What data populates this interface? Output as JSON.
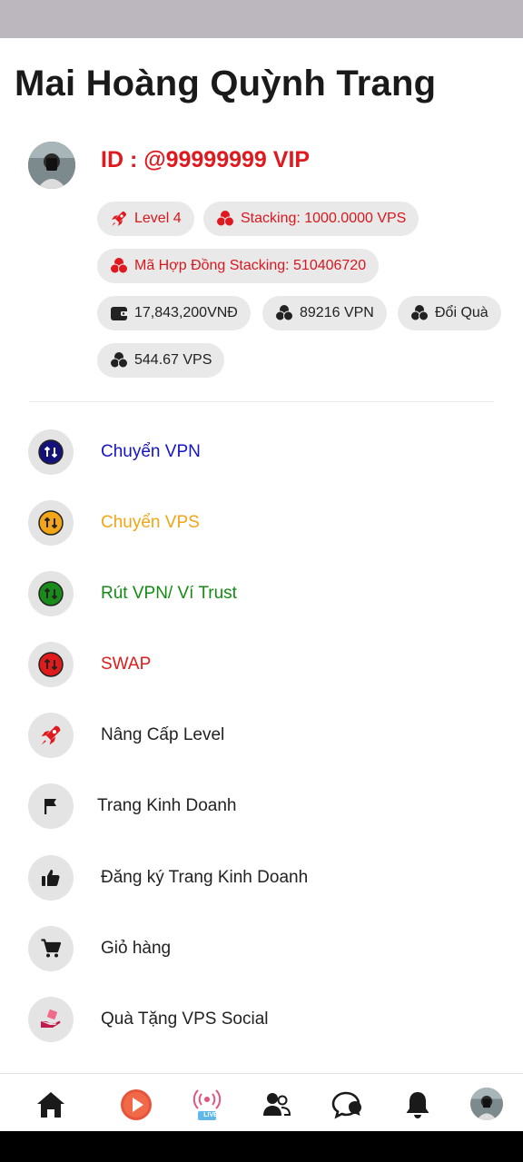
{
  "profile": {
    "name": "Mai Hoàng Quỳnh Trang",
    "id_text": "ID : @99999999 VIP"
  },
  "chips": {
    "level": "Level 4",
    "stacking": "Stacking: 1000.0000 VPS",
    "contract": "Mã Hợp Đồng Stacking: 510406720",
    "vnd": "17,843,200VNĐ",
    "vpn": "89216 VPN",
    "gift": "Đổi Quà",
    "vps": "544.67 VPS"
  },
  "menu": [
    {
      "label": "Chuyển VPN",
      "color": "#1414c8",
      "icon": "transfer-icon"
    },
    {
      "label": "Chuyển VPS",
      "color": "#f2a516",
      "icon": "transfer-icon"
    },
    {
      "label": "Rút VPN/ Ví Trust",
      "color": "#158a15",
      "icon": "transfer-icon"
    },
    {
      "label": "SWAP",
      "color": "#e01b1b",
      "icon": "transfer-icon"
    },
    {
      "label": "Nâng Cấp Level",
      "color": "#222222",
      "icon": "rocket-icon"
    },
    {
      "label": "Trang Kinh Doanh",
      "color": "#222222",
      "icon": "flag-icon"
    },
    {
      "label": "Đăng ký Trang Kinh Doanh",
      "color": "#222222",
      "icon": "thumbs-up-icon"
    },
    {
      "label": "Giỏ hàng",
      "color": "#222222",
      "icon": "cart-icon"
    },
    {
      "label": "Quà Tặng VPS Social",
      "color": "#222222",
      "icon": "gift-hand-icon"
    }
  ],
  "bottom_nav": {
    "live_badge": "LIVE",
    "items": [
      "home-icon",
      "play-icon",
      "live-icon",
      "friends-icon",
      "chat-icon",
      "bell-icon",
      "profile-avatar"
    ]
  },
  "colors": {
    "accent_red": "#e0191f",
    "chip_bg": "#e9e9e9",
    "icon_circle_bg": "#e4e4e4"
  }
}
